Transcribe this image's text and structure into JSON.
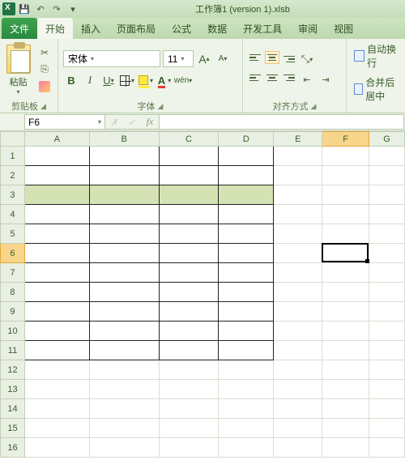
{
  "window": {
    "title": "工作簿1 (version 1).xlsb"
  },
  "qat": {
    "save": "💾",
    "undo": "↶",
    "redo": "↷",
    "dd": "▾"
  },
  "tabs": {
    "file": "文件",
    "items": [
      "开始",
      "插入",
      "页面布局",
      "公式",
      "数据",
      "开发工具",
      "审阅",
      "视图"
    ],
    "active": 0
  },
  "ribbon": {
    "clipboard": {
      "paste": "粘贴",
      "label": "剪贴板",
      "cut": "✂",
      "copy": "⎘"
    },
    "font": {
      "name": "宋体",
      "size": "11",
      "grow": "A",
      "shrink": "A",
      "label": "字体"
    },
    "align": {
      "wrap": "自动换行",
      "merge": "合并后居中",
      "label": "对齐方式"
    }
  },
  "formula": {
    "cellref": "F6",
    "fx": "fx"
  },
  "grid": {
    "cols": [
      "A",
      "B",
      "C",
      "D",
      "E",
      "F",
      "G"
    ],
    "rows": 16,
    "activeCol": "F",
    "activeRow": 6,
    "highlightRow": 3,
    "borderRegion": {
      "r1": 1,
      "r2": 11,
      "c1": 0,
      "c2": 3
    }
  }
}
